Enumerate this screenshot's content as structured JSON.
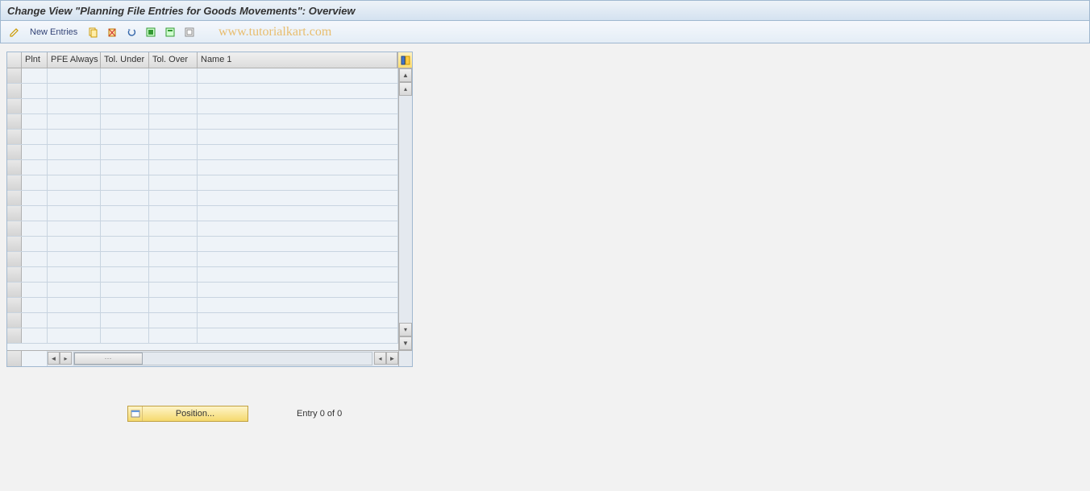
{
  "title": "Change View \"Planning File Entries for Goods Movements\": Overview",
  "toolbar": {
    "new_entries_label": "New Entries"
  },
  "watermark": "www.tutorialkart.com",
  "table": {
    "columns": {
      "plnt": "Plnt",
      "pfe_always": "PFE Always",
      "tol_under": "Tol. Under",
      "tol_over": "Tol. Over",
      "name1": "Name 1"
    },
    "row_count": 18
  },
  "footer": {
    "position_label": "Position...",
    "entry_text": "Entry 0 of 0"
  }
}
